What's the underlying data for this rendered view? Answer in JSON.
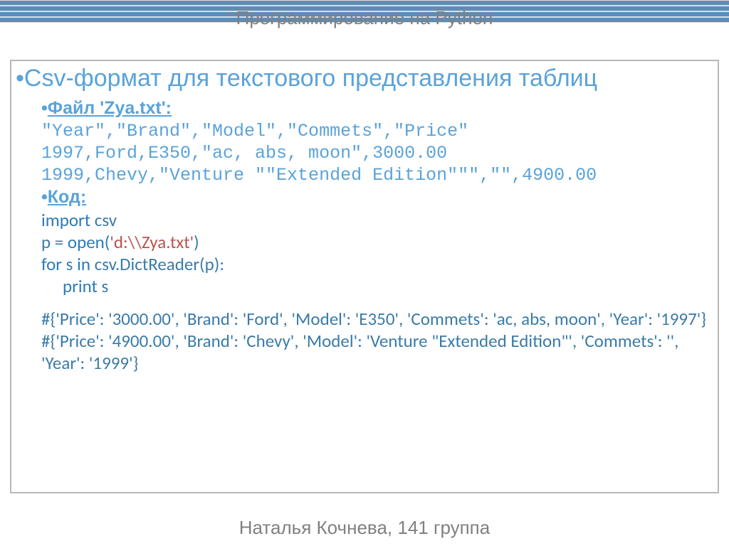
{
  "header": {
    "title": "Программирование на Python"
  },
  "footer": {
    "title": "Наталья Кочнева, 141 группа"
  },
  "main": {
    "title": "Csv-формат для текстового представления таблиц",
    "file_label": "Файл 'Zya.txt':",
    "csv_line1": "\"Year\",\"Brand\",\"Model\",\"Commets\",\"Price\"",
    "csv_line2": "1997,Ford,E350,\"ac, abs, moon\",3000.00",
    "csv_line3": "1999,Chevy,\"Venture \"\"Extended Edition\"\"\",\"\",4900.00",
    "code_label": "Код:",
    "code": {
      "l1_import": "import",
      "l1_csv": " csv",
      "l2_p": "p = ",
      "l2_open": "open(",
      "l2_str": "'d:\\\\Zya.txt'",
      "l2_close": ")",
      "l3_for": "for",
      "l3_s_in": " s ",
      "l3_in": "in",
      "l3_rest": " csv.DictReader(p):",
      "l4_print": "print",
      "l4_s": " s"
    },
    "out1": "#{'Price': '3000.00', 'Brand': 'Ford', 'Model': 'E350', 'Commets': 'ac, abs, moon', 'Year': '1997'}",
    "out2": "#{'Price': '4900.00', 'Brand': 'Chevy', 'Model': 'Venture \"Extended Edition\"', 'Commets': '', 'Year': '1999'}"
  }
}
